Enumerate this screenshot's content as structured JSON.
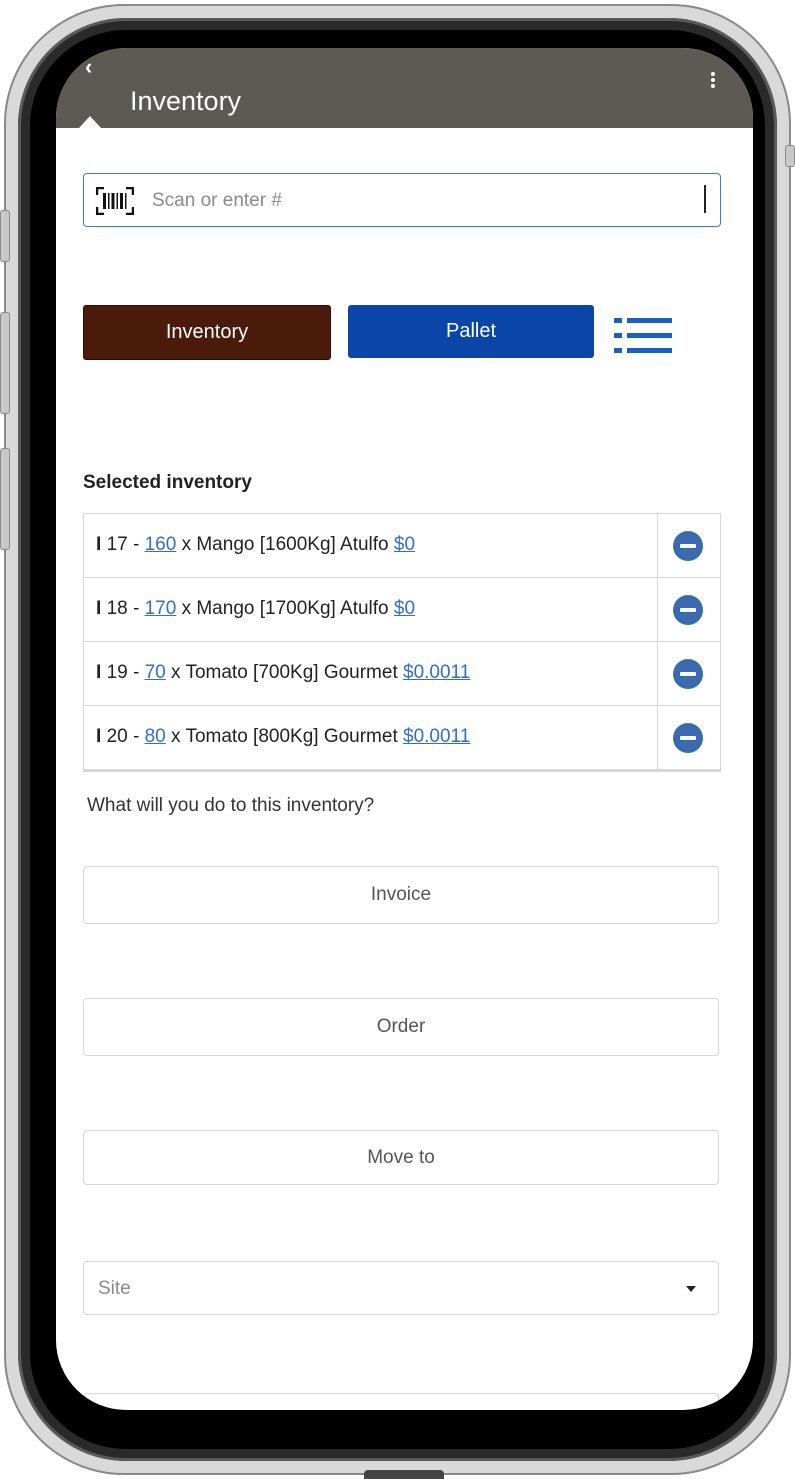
{
  "app_bar": {
    "back_label": "‹",
    "title": "Inventory",
    "menu_icon": "kebab-menu-icon"
  },
  "scan": {
    "icon": "barcode-icon",
    "placeholder": "Scan or enter #"
  },
  "mode_buttons": {
    "inventory_label": "Inventory",
    "pallet_label": "Pallet",
    "list_icon": "list-icon",
    "inventory_color": "#4a1b0a",
    "pallet_color": "#0a46a7"
  },
  "selected": {
    "heading": "Selected inventory",
    "items": [
      {
        "marker": "I",
        "id": "17",
        "qty": "160",
        "desc": "x Mango [1600Kg] Atulfo",
        "price": "$0"
      },
      {
        "marker": "I",
        "id": "18",
        "qty": "170",
        "desc": "x Mango [1700Kg] Atulfo",
        "price": "$0"
      },
      {
        "marker": "I",
        "id": "19",
        "qty": "70",
        "desc": "x Tomato [700Kg] Gourmet",
        "price": "$0.0011"
      },
      {
        "marker": "I",
        "id": "20",
        "qty": "80",
        "desc": "x Tomato [800Kg] Gourmet",
        "price": "$0.0011"
      }
    ]
  },
  "actions": {
    "question": "What will you do to this inventory?",
    "invoice_label": "Invoice",
    "order_label": "Order",
    "move_label": "Move to",
    "site_placeholder": "Site"
  },
  "colors": {
    "app_bar": "#5b5a55",
    "link": "#2f6fc8",
    "remove_icon": "#3a6ab0"
  }
}
